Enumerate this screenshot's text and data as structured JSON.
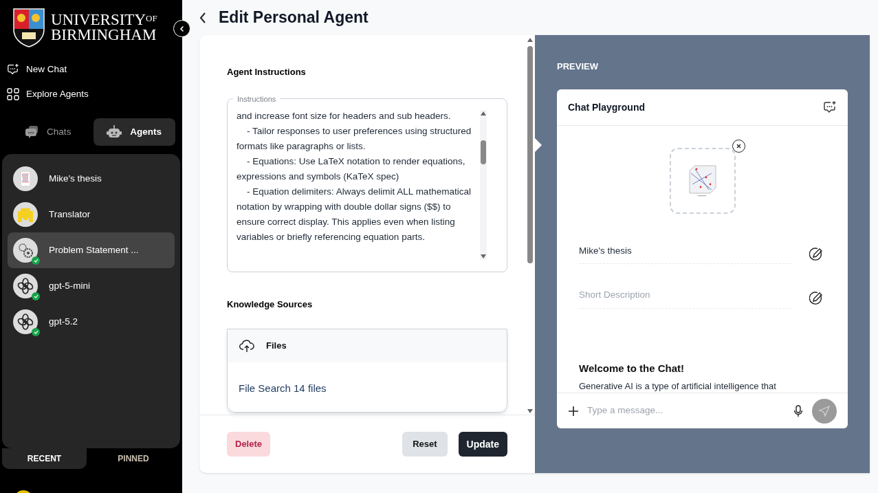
{
  "logo": {
    "line1": "UNIVERSITY",
    "of": "OF",
    "line2": "BIRMINGHAM"
  },
  "nav": [
    {
      "label": "New Chat",
      "kind": "chat"
    },
    {
      "label": "Explore Agents",
      "kind": "grid"
    }
  ],
  "tabs": [
    {
      "label": "Chats",
      "kind": "chats",
      "selected": false
    },
    {
      "label": "Agents",
      "kind": "agents",
      "selected": true
    }
  ],
  "agents": [
    {
      "name": "Mike's thesis",
      "kind": "picture",
      "verified": false,
      "selected": false
    },
    {
      "name": "Translator",
      "kind": "translator",
      "verified": false,
      "selected": false
    },
    {
      "name": "Problem Statement ...",
      "kind": "gears",
      "verified": true,
      "selected": true
    },
    {
      "name": "gpt-5-mini",
      "kind": "knot",
      "verified": true,
      "selected": false
    },
    {
      "name": "gpt-5.2",
      "kind": "knot",
      "verified": true,
      "selected": false
    }
  ],
  "list_tabs": [
    {
      "label": "RECENT",
      "selected": true
    },
    {
      "label": "PINNED",
      "selected": false
    }
  ],
  "page_title": "Edit Personal Agent",
  "instructions": {
    "heading": "Agent Instructions",
    "label": "Instructions",
    "text": "and increase font size for headers and sub headers.\n    - Tailor responses to user preferences using structured formats like paragraphs or lists.\n    - Equations: Use LaTeX notation to render equations, expressions and symbols (KaTeX spec)\n    - Equation delimiters: Always delimit ALL mathematical notation by wrapping with double dollar signs ($$) to ensure correct display. This applies even when listing variables or briefly referencing equation parts."
  },
  "knowledge": {
    "heading": "Knowledge Sources",
    "title": "Files",
    "body": "File Search 14 files"
  },
  "buttons": {
    "delete": "Delete",
    "reset": "Reset",
    "update": "Update"
  },
  "preview": {
    "label": "PREVIEW",
    "title": "Chat Playground",
    "name": "Mike's thesis",
    "description_placeholder": "Short Description",
    "welcome": "Welcome to the Chat!",
    "message": "Generative AI is a type of artificial intelligence that",
    "input_placeholder": "Type a message..."
  }
}
